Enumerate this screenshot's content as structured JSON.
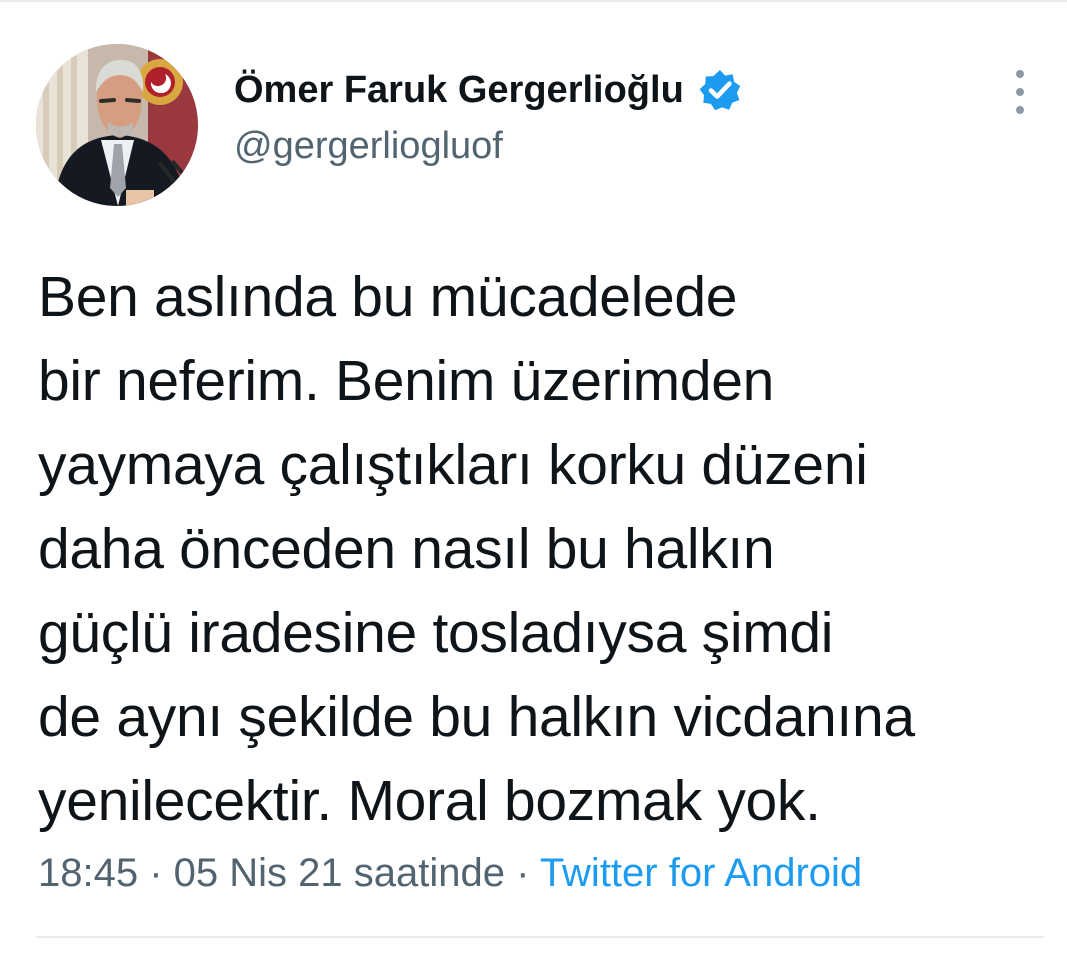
{
  "tweet": {
    "author": {
      "name": "Ömer Faruk Gergerlioğlu",
      "handle": "@gergerliogluof",
      "verified": true,
      "avatar": "profile-photo"
    },
    "text": "Ben aslında bu mücadelede\nbir neferim. Benim üzerimden\nyaymaya çalıştıkları korku düzeni\ndaha önceden nasıl bu halkın\ngüçlü iradesine tosladıysa şimdi\nde aynı şekilde bu halkın vicdanına\nyenilecektir. Moral bozmak yok.",
    "time": "18:45",
    "separator": " · ",
    "date": "05 Nis 21 saatinde",
    "source": "Twitter for Android"
  },
  "icons": {
    "verified": "verified-badge-icon",
    "more": "more-options-icon"
  },
  "colors": {
    "text": "#0f1419",
    "secondary": "#536471",
    "link": "#1d9bf0",
    "divider": "#e6ecf0"
  }
}
